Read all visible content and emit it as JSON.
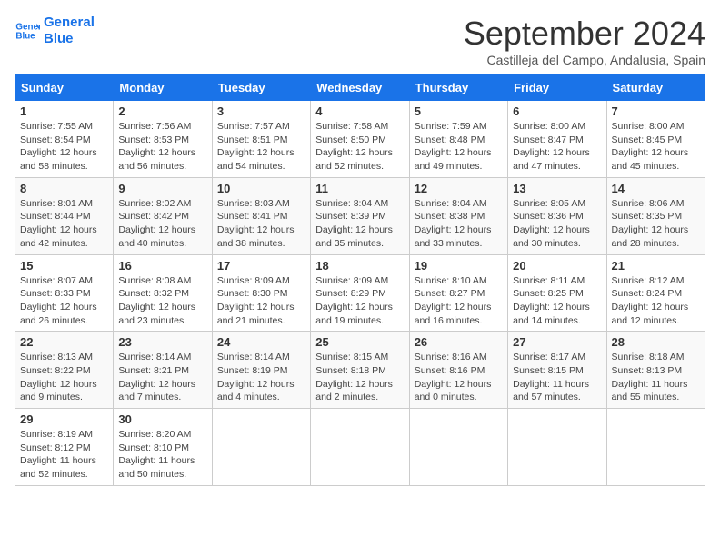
{
  "header": {
    "logo_line1": "General",
    "logo_line2": "Blue",
    "title": "September 2024",
    "subtitle": "Castilleja del Campo, Andalusia, Spain"
  },
  "columns": [
    "Sunday",
    "Monday",
    "Tuesday",
    "Wednesday",
    "Thursday",
    "Friday",
    "Saturday"
  ],
  "weeks": [
    [
      {
        "day": "1",
        "info": "Sunrise: 7:55 AM\nSunset: 8:54 PM\nDaylight: 12 hours\nand 58 minutes."
      },
      {
        "day": "2",
        "info": "Sunrise: 7:56 AM\nSunset: 8:53 PM\nDaylight: 12 hours\nand 56 minutes."
      },
      {
        "day": "3",
        "info": "Sunrise: 7:57 AM\nSunset: 8:51 PM\nDaylight: 12 hours\nand 54 minutes."
      },
      {
        "day": "4",
        "info": "Sunrise: 7:58 AM\nSunset: 8:50 PM\nDaylight: 12 hours\nand 52 minutes."
      },
      {
        "day": "5",
        "info": "Sunrise: 7:59 AM\nSunset: 8:48 PM\nDaylight: 12 hours\nand 49 minutes."
      },
      {
        "day": "6",
        "info": "Sunrise: 8:00 AM\nSunset: 8:47 PM\nDaylight: 12 hours\nand 47 minutes."
      },
      {
        "day": "7",
        "info": "Sunrise: 8:00 AM\nSunset: 8:45 PM\nDaylight: 12 hours\nand 45 minutes."
      }
    ],
    [
      {
        "day": "8",
        "info": "Sunrise: 8:01 AM\nSunset: 8:44 PM\nDaylight: 12 hours\nand 42 minutes."
      },
      {
        "day": "9",
        "info": "Sunrise: 8:02 AM\nSunset: 8:42 PM\nDaylight: 12 hours\nand 40 minutes."
      },
      {
        "day": "10",
        "info": "Sunrise: 8:03 AM\nSunset: 8:41 PM\nDaylight: 12 hours\nand 38 minutes."
      },
      {
        "day": "11",
        "info": "Sunrise: 8:04 AM\nSunset: 8:39 PM\nDaylight: 12 hours\nand 35 minutes."
      },
      {
        "day": "12",
        "info": "Sunrise: 8:04 AM\nSunset: 8:38 PM\nDaylight: 12 hours\nand 33 minutes."
      },
      {
        "day": "13",
        "info": "Sunrise: 8:05 AM\nSunset: 8:36 PM\nDaylight: 12 hours\nand 30 minutes."
      },
      {
        "day": "14",
        "info": "Sunrise: 8:06 AM\nSunset: 8:35 PM\nDaylight: 12 hours\nand 28 minutes."
      }
    ],
    [
      {
        "day": "15",
        "info": "Sunrise: 8:07 AM\nSunset: 8:33 PM\nDaylight: 12 hours\nand 26 minutes."
      },
      {
        "day": "16",
        "info": "Sunrise: 8:08 AM\nSunset: 8:32 PM\nDaylight: 12 hours\nand 23 minutes."
      },
      {
        "day": "17",
        "info": "Sunrise: 8:09 AM\nSunset: 8:30 PM\nDaylight: 12 hours\nand 21 minutes."
      },
      {
        "day": "18",
        "info": "Sunrise: 8:09 AM\nSunset: 8:29 PM\nDaylight: 12 hours\nand 19 minutes."
      },
      {
        "day": "19",
        "info": "Sunrise: 8:10 AM\nSunset: 8:27 PM\nDaylight: 12 hours\nand 16 minutes."
      },
      {
        "day": "20",
        "info": "Sunrise: 8:11 AM\nSunset: 8:25 PM\nDaylight: 12 hours\nand 14 minutes."
      },
      {
        "day": "21",
        "info": "Sunrise: 8:12 AM\nSunset: 8:24 PM\nDaylight: 12 hours\nand 12 minutes."
      }
    ],
    [
      {
        "day": "22",
        "info": "Sunrise: 8:13 AM\nSunset: 8:22 PM\nDaylight: 12 hours\nand 9 minutes."
      },
      {
        "day": "23",
        "info": "Sunrise: 8:14 AM\nSunset: 8:21 PM\nDaylight: 12 hours\nand 7 minutes."
      },
      {
        "day": "24",
        "info": "Sunrise: 8:14 AM\nSunset: 8:19 PM\nDaylight: 12 hours\nand 4 minutes."
      },
      {
        "day": "25",
        "info": "Sunrise: 8:15 AM\nSunset: 8:18 PM\nDaylight: 12 hours\nand 2 minutes."
      },
      {
        "day": "26",
        "info": "Sunrise: 8:16 AM\nSunset: 8:16 PM\nDaylight: 12 hours\nand 0 minutes."
      },
      {
        "day": "27",
        "info": "Sunrise: 8:17 AM\nSunset: 8:15 PM\nDaylight: 11 hours\nand 57 minutes."
      },
      {
        "day": "28",
        "info": "Sunrise: 8:18 AM\nSunset: 8:13 PM\nDaylight: 11 hours\nand 55 minutes."
      }
    ],
    [
      {
        "day": "29",
        "info": "Sunrise: 8:19 AM\nSunset: 8:12 PM\nDaylight: 11 hours\nand 52 minutes."
      },
      {
        "day": "30",
        "info": "Sunrise: 8:20 AM\nSunset: 8:10 PM\nDaylight: 11 hours\nand 50 minutes."
      },
      null,
      null,
      null,
      null,
      null
    ]
  ]
}
